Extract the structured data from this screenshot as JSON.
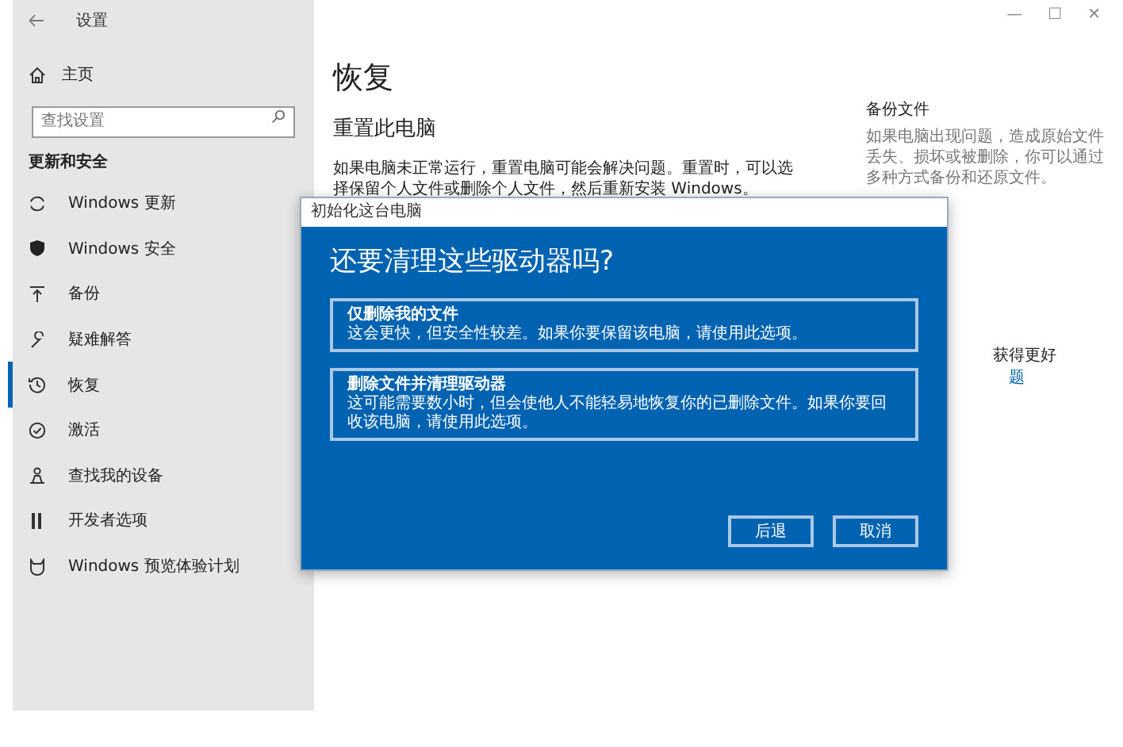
{
  "window": {
    "title": "设置",
    "controls": [
      "—",
      "☐",
      "✕"
    ]
  },
  "sidebar": {
    "home": "主页",
    "search": {
      "placeholder": "查找设置"
    },
    "section": "更新和安全",
    "items": [
      {
        "label": "Windows 更新",
        "selected": false
      },
      {
        "label": "Windows 安全",
        "selected": false
      },
      {
        "label": "备份",
        "selected": false
      },
      {
        "label": "疑难解答",
        "selected": false
      },
      {
        "label": "恢复",
        "selected": true
      },
      {
        "label": "激活",
        "selected": false
      },
      {
        "label": "查找我的设备",
        "selected": false
      },
      {
        "label": "开发者选项",
        "selected": false
      },
      {
        "label": "Windows 预览体验计划",
        "selected": false
      }
    ]
  },
  "main": {
    "title": "恢复",
    "section": "重置此电脑",
    "description": "如果电脑未正常运行，重置电脑可能会解决问题。重置时，可以选择保留个人文件或删除个人文件，然后重新安装 Windows。"
  },
  "side_panel": {
    "heading": "备份文件",
    "text": "如果电脑出现问题，造成原始文件丢失、损坏或被删除，你可以通过多种方式备份和还原文件。",
    "heading_2": "获得更好",
    "link": "题"
  },
  "dialog": {
    "title": "初始化这台电脑",
    "question": "还要清理这些驱动器吗?",
    "options": [
      {
        "title": "仅删除我的文件",
        "description": "这会更快，但安全性较差。如果你要保留该电脑，请使用此选项。"
      },
      {
        "title": "删除文件并清理驱动器",
        "description": "这可能需要数小时，但会使他人不能轻易地恢复你的已删除文件。如果你要回收该电脑，请使用此选项。"
      }
    ],
    "buttons": [
      "后退",
      "取消"
    ]
  }
}
